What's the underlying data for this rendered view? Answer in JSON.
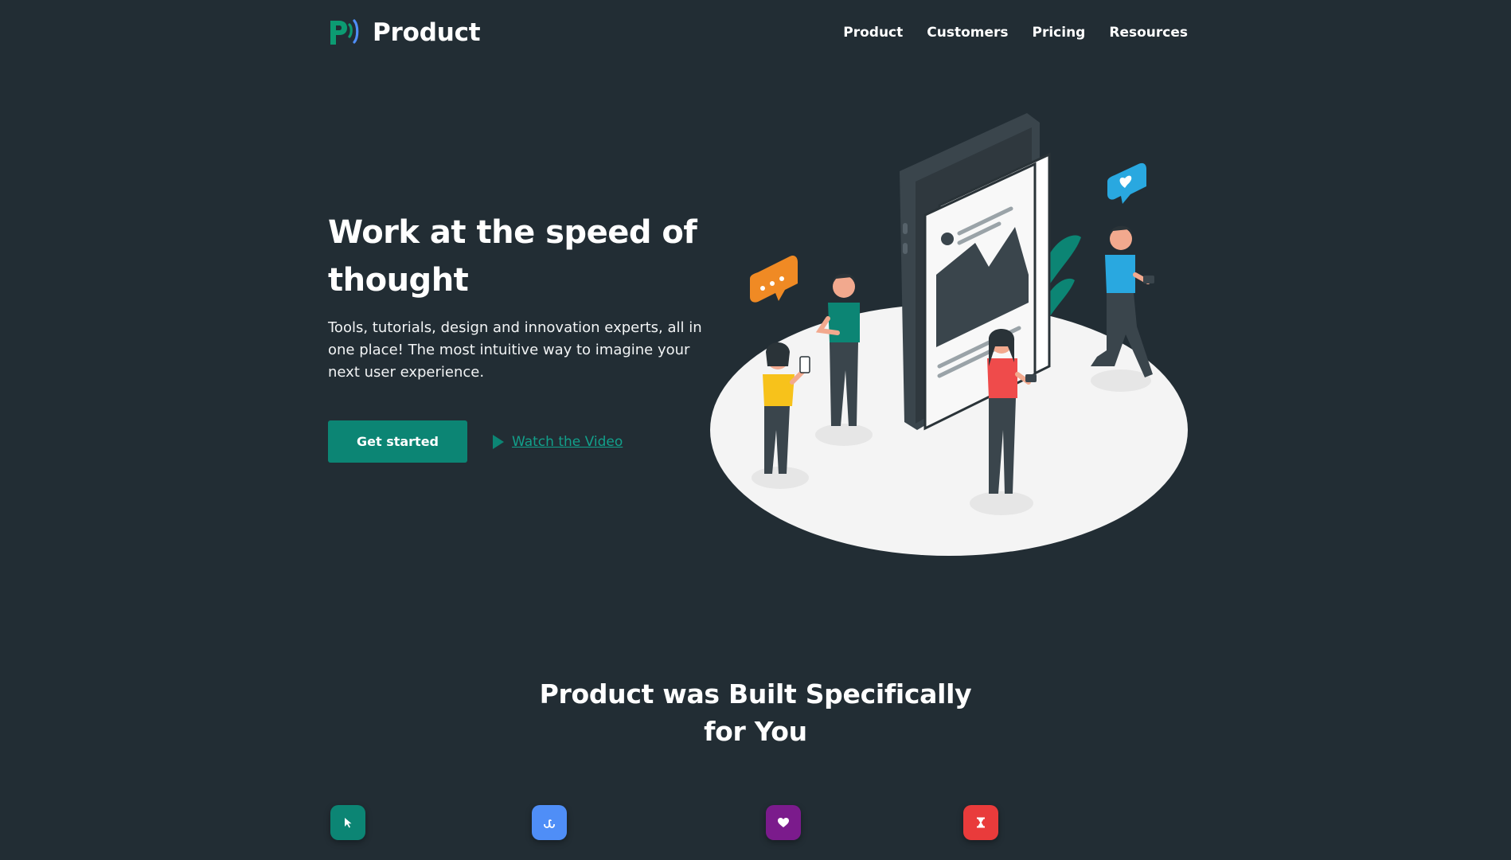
{
  "brand": {
    "name": "Product",
    "accent": "#0c8574",
    "logo_icon": "product-p-logo-icon"
  },
  "nav": {
    "items": [
      {
        "label": "Product"
      },
      {
        "label": "Customers"
      },
      {
        "label": "Pricing"
      },
      {
        "label": "Resources"
      }
    ]
  },
  "hero": {
    "title": "Work at the speed of thought",
    "subtitle": "Tools, tutorials, design and innovation experts, all in one place! The most intuitive way to imagine your next user experience.",
    "primary_cta": "Get started",
    "secondary_cta": "Watch the Video",
    "secondary_icon": "play-icon",
    "illustration": "people-with-phones-around-giant-smartphone-illustration"
  },
  "features": {
    "title": "Product was Built Specifically for You",
    "icons": [
      {
        "name": "cursor-icon",
        "color": "#0c8574"
      },
      {
        "name": "stumbleupon-icon",
        "color": "#4f8ef7"
      },
      {
        "name": "heart-icon",
        "color": "#7b1b8c"
      },
      {
        "name": "hourglass-icon",
        "color": "#e93b3b"
      }
    ]
  }
}
